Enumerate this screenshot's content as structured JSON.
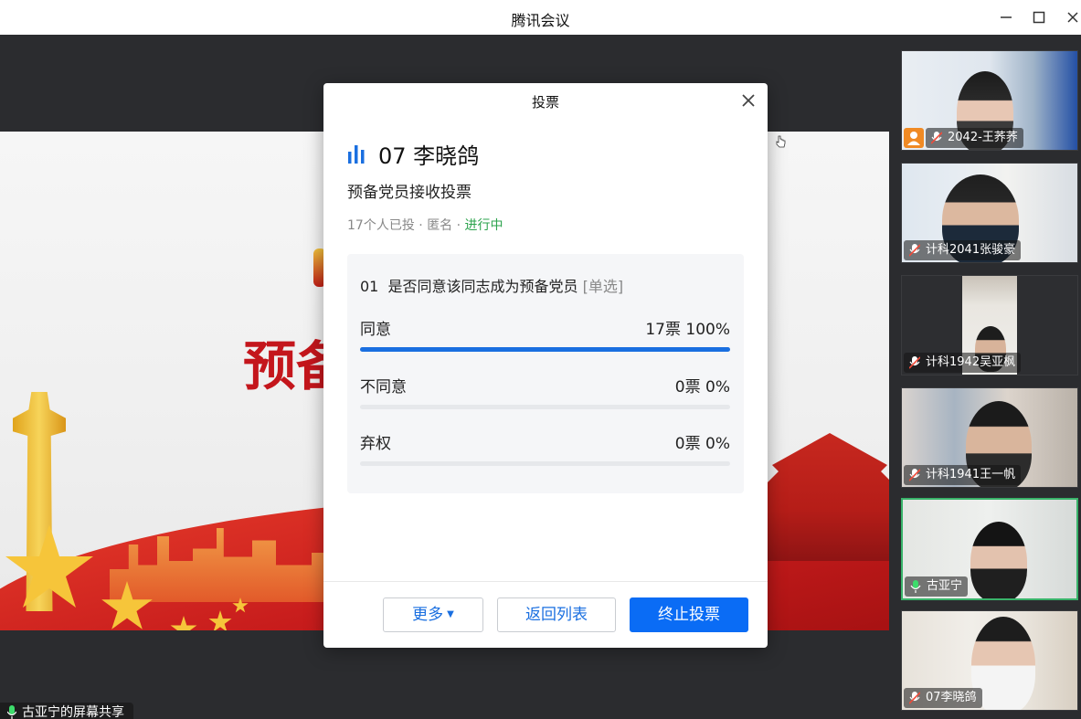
{
  "window": {
    "title": "腾讯会议"
  },
  "stage": {
    "slide_text": "预备",
    "share_label": "古亚宁的屏幕共享"
  },
  "participants": [
    {
      "name": "2042-王荞荞",
      "host": true,
      "active": false
    },
    {
      "name": "计科2041张骏豪",
      "host": false,
      "active": false
    },
    {
      "name": "计科1942吴亚枫",
      "host": false,
      "active": false
    },
    {
      "name": "计科1941王一帆",
      "host": false,
      "active": false
    },
    {
      "name": "古亚宁",
      "host": false,
      "active": true
    },
    {
      "name": "07李晓鸽",
      "host": false,
      "active": false
    }
  ],
  "poll": {
    "dialog_title": "投票",
    "title": "07 李晓鸽",
    "subtitle": "预备党员接收投票",
    "meta_count": "17个人已投",
    "meta_sep1": " · ",
    "meta_anon": "匿名",
    "meta_sep2": " · ",
    "meta_status": "进行中",
    "question": {
      "number": "01",
      "text": "是否同意该同志成为预备党员",
      "type": "[单选]",
      "options": [
        {
          "label": "同意",
          "votes": "17票",
          "percent": "100%",
          "fraction": 1.0
        },
        {
          "label": "不同意",
          "votes": "0票",
          "percent": "0%",
          "fraction": 0.0
        },
        {
          "label": "弃权",
          "votes": "0票",
          "percent": "0%",
          "fraction": 0.0
        }
      ]
    },
    "buttons": {
      "more": "更多",
      "back": "返回列表",
      "stop": "终止投票"
    }
  },
  "colors": {
    "accent": "#1a6fe0",
    "primary_button": "#0a6cf5",
    "status_green": "#2ba34c",
    "active_border": "#39b36a",
    "host_badge": "#f08a24"
  }
}
